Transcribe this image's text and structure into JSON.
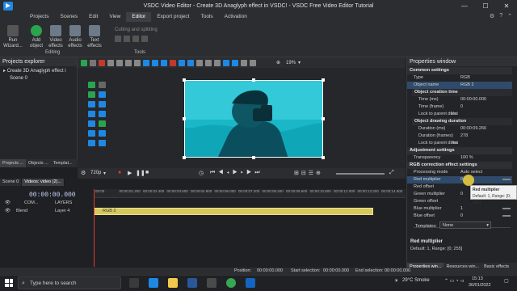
{
  "window": {
    "title": "VSDC Video Editor - Create 3D Anaglyph effect in VSDC! - VSDC Free Video Editor Tutorial",
    "min": "—",
    "max": "☐",
    "close": "✕"
  },
  "menu": {
    "items": [
      "Projects",
      "Scenes",
      "Edit",
      "View",
      "Editor",
      "Export project",
      "Tools",
      "Activation"
    ],
    "active": "Editor"
  },
  "ribbon": {
    "run_wizard": "Run\nWizard...",
    "add_object": "Add\nobject",
    "video_effects": "Video\neffects",
    "audio_effects": "Audio\neffects",
    "text_effects": "Text\neffects",
    "group_editing": "Editing",
    "cutting_splitting": "Cutting and splitting",
    "group_tools": "Tools"
  },
  "explorer": {
    "title": "Projects explorer",
    "project": "Create 3D Anaglyph effect i",
    "scene": "Scene 0",
    "tabs": [
      "Projects ...",
      "Objects ...",
      "Templat..."
    ]
  },
  "editor_toolbar": {
    "zoom": "19%"
  },
  "playbar": {
    "quality": "720p"
  },
  "timeline": {
    "tabs": [
      "Scene 0",
      "Videos: video (2)..."
    ],
    "timecode": "00:00:00.000",
    "com_label": "COM...",
    "layers_label": "LAYERS",
    "blend_label": "Blend",
    "layer_label": "Layer 4",
    "clip_label": "RGB 2",
    "ruler": [
      "00:00",
      "00:00:01.200",
      "00:00:02.400",
      "00:00:03.600",
      "00:00:04.800",
      "00:00:06.000",
      "00:00:07.200",
      "00:00:08.400",
      "00:00:09.600",
      "00:00:10.800",
      "00:00:12.000",
      "00:00:13.200",
      "00:00:14.600"
    ]
  },
  "properties": {
    "title": "Properties window",
    "sections": {
      "common": "Common settings",
      "creation": "Object creation time",
      "drawing": "Object drawing duration",
      "adjustment": "Adjustment settings",
      "rgb": "RGB correction effect settings"
    },
    "rows": {
      "type": [
        "Type",
        "RGB"
      ],
      "object_name": [
        "Object name",
        "RGB 2"
      ],
      "time_ms": [
        "Time (ms)",
        "00:00:00.000"
      ],
      "time_frame": [
        "Time (frame)",
        "0"
      ],
      "lock_parent1": [
        "Lock to parent durat",
        "No"
      ],
      "duration_ms": [
        "Duration (ms)",
        "00:00:09.266"
      ],
      "duration_frames": [
        "Duration (frames)",
        "278"
      ],
      "lock_parent2": [
        "Lock to parent durat",
        "Yes"
      ],
      "transparency": [
        "Transparency",
        "100 %"
      ],
      "processing_mode": [
        "Processing mode",
        "Auto select"
      ],
      "red_multiplier": [
        "Red multiplier",
        "0"
      ],
      "red_offset": [
        "Red offset",
        ""
      ],
      "green_multiplier": [
        "Green multiplier",
        "0"
      ],
      "green_offset": [
        "Green offset",
        ""
      ],
      "blue_multiplier": [
        "Blue multiplier",
        "1"
      ],
      "blue_offset": [
        "Blue offset",
        "0"
      ],
      "templates": [
        "Templates:",
        "None"
      ]
    },
    "tooltip_title": "Red multiplier",
    "tooltip_text": "Default: 1, Range: [0; 255]",
    "desc_title": "Red multiplier",
    "desc_text": "Default: 1, Range: [0; 255]",
    "bottom_tabs": [
      "Properties win...",
      "Resources win...",
      "Basic effects"
    ]
  },
  "status": {
    "position": "Position:",
    "position_val": "00:00:00.000",
    "start_sel": "Start selection:",
    "start_val": "00:00:00.000",
    "end_sel": "End selection:",
    "end_val": "00:00:00.000",
    "zoom": "19%"
  },
  "taskbar": {
    "search": "Type here to search",
    "weather": "29°C  Smoke",
    "time": "15:13",
    "date": "30/01/2022"
  }
}
